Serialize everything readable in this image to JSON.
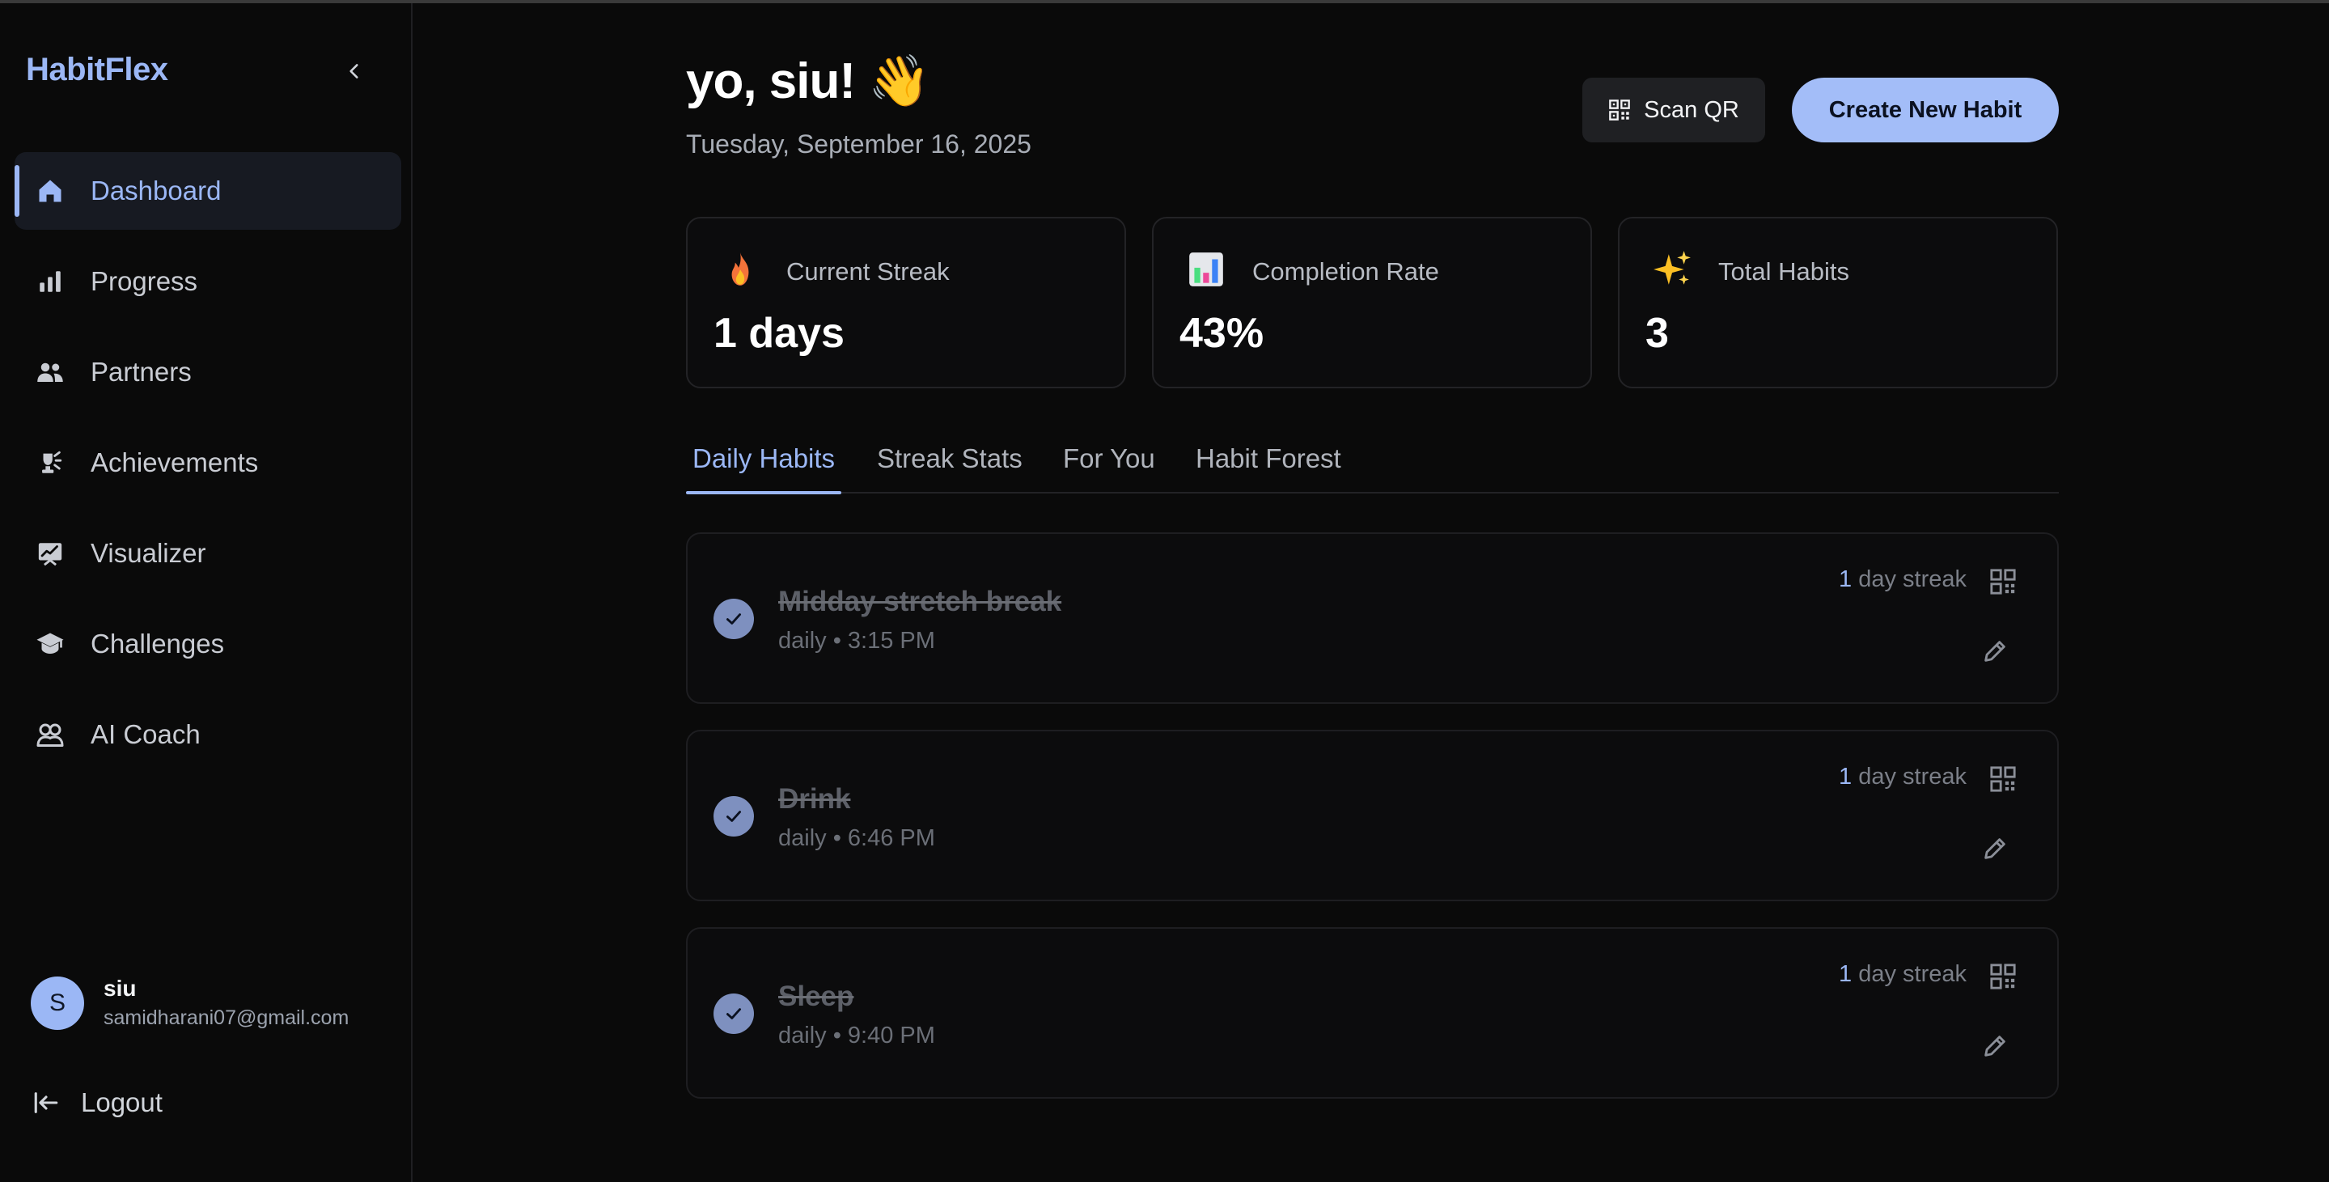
{
  "app": {
    "brand": "HabitFlex"
  },
  "sidebar": {
    "items": [
      {
        "label": "Dashboard",
        "icon": "home-icon"
      },
      {
        "label": "Progress",
        "icon": "bar-chart-icon"
      },
      {
        "label": "Partners",
        "icon": "people-icon"
      },
      {
        "label": "Achievements",
        "icon": "trophy-icon"
      },
      {
        "label": "Visualizer",
        "icon": "trend-chart-icon"
      },
      {
        "label": "Challenges",
        "icon": "graduation-cap-icon"
      },
      {
        "label": "AI Coach",
        "icon": "coach-icon"
      }
    ],
    "active": "Dashboard",
    "user": {
      "initial": "S",
      "name": "siu",
      "email": "samidharani07@gmail.com"
    },
    "logout_label": "Logout"
  },
  "header": {
    "greeting": "yo, siu! 👋",
    "date": "Tuesday, September 16, 2025",
    "scan_label": "Scan QR",
    "create_label": "Create New Habit"
  },
  "stats": [
    {
      "icon": "fire-icon",
      "label": "Current Streak",
      "value": "1 days"
    },
    {
      "icon": "chart-icon",
      "label": "Completion Rate",
      "value": "43%"
    },
    {
      "icon": "sparkles-icon",
      "label": "Total Habits",
      "value": "3"
    }
  ],
  "tabs": [
    {
      "label": "Daily Habits",
      "active": true
    },
    {
      "label": "Streak Stats",
      "active": false
    },
    {
      "label": "For You",
      "active": false
    },
    {
      "label": "Habit Forest",
      "active": false
    }
  ],
  "habits": [
    {
      "name": "Midday stretch break",
      "meta": "daily • 3:15 PM",
      "streak_num": "1",
      "streak_text": " day streak",
      "completed": true
    },
    {
      "name": "Drink",
      "meta": "daily • 6:46 PM",
      "streak_num": "1",
      "streak_text": " day streak",
      "completed": true
    },
    {
      "name": "Sleep",
      "meta": "daily • 9:40 PM",
      "streak_num": "1",
      "streak_text": " day streak",
      "completed": true
    }
  ],
  "colors": {
    "accent": "#9bb7f5",
    "background": "#0a0a0a",
    "card_border": "#232326",
    "check": "#7e90bf"
  }
}
